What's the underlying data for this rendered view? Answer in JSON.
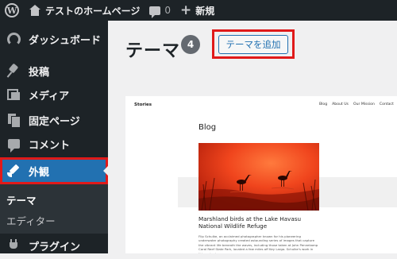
{
  "adminbar": {
    "site_name": "テストのホームページ",
    "comments_count": "0",
    "new_label": "新規"
  },
  "sidebar": {
    "items": [
      {
        "label": "ダッシュボード",
        "icon": "dashboard-icon"
      },
      {
        "label": "投稿",
        "icon": "pin-icon"
      },
      {
        "label": "メディア",
        "icon": "media-icon"
      },
      {
        "label": "固定ページ",
        "icon": "page-icon"
      },
      {
        "label": "コメント",
        "icon": "comment-icon"
      },
      {
        "label": "外観",
        "icon": "paintbrush-icon"
      },
      {
        "label": "プラグイン",
        "icon": "plugin-icon"
      }
    ],
    "submenu": [
      {
        "label": "テーマ"
      },
      {
        "label": "エディター"
      }
    ],
    "colors": {
      "background": "#1d2327",
      "active": "#2271b1",
      "highlight": "#e01a1a"
    }
  },
  "main": {
    "title": "テーマ",
    "theme_count": "4",
    "add_button": "テーマを追加"
  },
  "theme_preview": {
    "site_name": "Stories",
    "nav": [
      "Blog",
      "About Us",
      "Our Mission",
      "Contact"
    ],
    "heading": "Blog",
    "post_title": "Marshland birds at the Lake Havasu National Wildlife Refuge",
    "post_excerpt": "Flip Schulke, an acclaimed photographer known for his pioneering underwater photography created astounding series of images that capture the vibrant life beneath the waves, including those taken at John Pennekamp Coral Reef State Park, located a few miles off Key Largo. Schulke's work in this series is"
  }
}
